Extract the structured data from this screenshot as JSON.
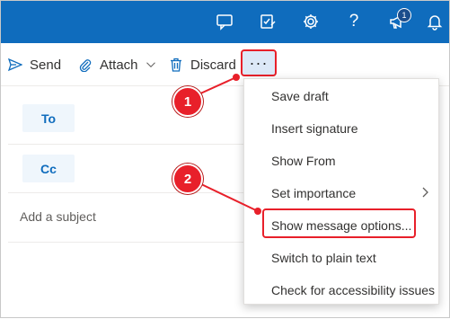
{
  "topbar": {
    "color": "#0f6cbd",
    "icons": [
      "chat-icon",
      "edit-check-icon",
      "gear-icon",
      "help-icon",
      "megaphone-icon",
      "bell-icon"
    ],
    "help_glyph": "?",
    "notification_count": "1"
  },
  "toolbar": {
    "send_label": "Send",
    "attach_label": "Attach",
    "discard_label": "Discard",
    "more_glyph": "···"
  },
  "compose": {
    "to_label": "To",
    "cc_label": "Cc",
    "subject_placeholder": "Add a subject"
  },
  "menu": {
    "items": [
      {
        "label": "Save draft"
      },
      {
        "label": "Insert signature"
      },
      {
        "label": "Show From"
      },
      {
        "label": "Set importance"
      },
      {
        "label": "Show message options..."
      },
      {
        "label": "Switch to plain text"
      },
      {
        "label": "Check for accessibility issues"
      }
    ]
  },
  "annotations": {
    "step1": "1",
    "step2": "2",
    "color": "#e8202a"
  }
}
